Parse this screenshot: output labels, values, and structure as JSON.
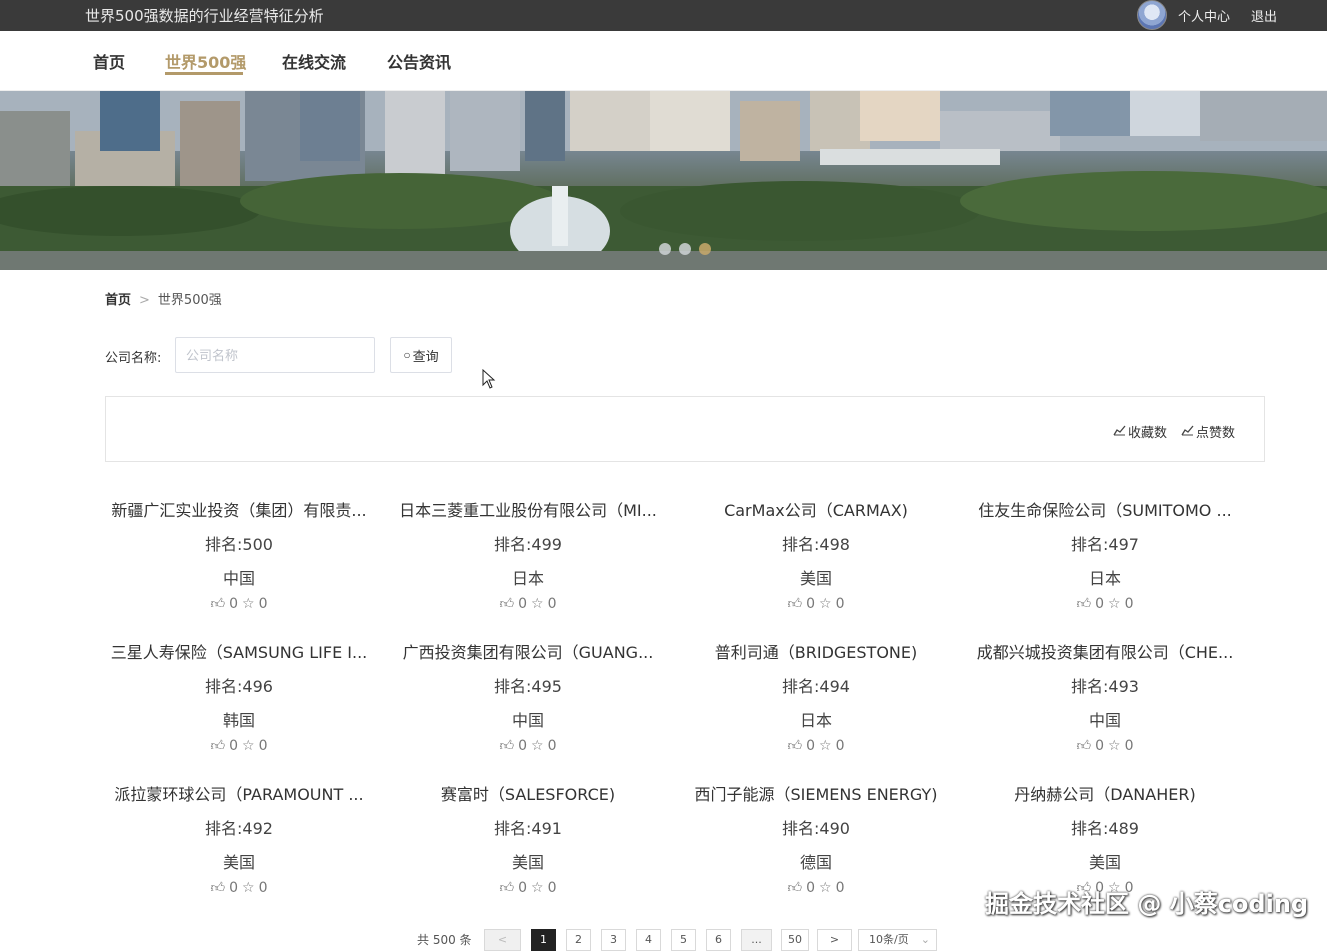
{
  "topbar": {
    "site_title": "世界500强数据的行业经营特征分析",
    "user_center": "个人中心",
    "logout": "退出"
  },
  "nav": {
    "items": [
      "首页",
      "世界500强",
      "在线交流",
      "公告资讯"
    ],
    "active_index": 1
  },
  "breadcrumb": {
    "home": "首页",
    "separator": ">",
    "current": "世界500强"
  },
  "search": {
    "label": "公司名称:",
    "placeholder": "公司名称",
    "button_label": "查询"
  },
  "sort": {
    "favorites": "收藏数",
    "likes": "点赞数"
  },
  "companies": [
    {
      "name": "新疆广汇实业投资（集团）有限责...",
      "rank": "排名:500",
      "country": "中国",
      "likes": "0",
      "favs": "0"
    },
    {
      "name": "日本三菱重工业股份有限公司（MI...",
      "rank": "排名:499",
      "country": "日本",
      "likes": "0",
      "favs": "0"
    },
    {
      "name": "CarMax公司（CARMAX)",
      "rank": "排名:498",
      "country": "美国",
      "likes": "0",
      "favs": "0"
    },
    {
      "name": "住友生命保险公司（SUMITOMO ...",
      "rank": "排名:497",
      "country": "日本",
      "likes": "0",
      "favs": "0"
    },
    {
      "name": "三星人寿保险（SAMSUNG LIFE I...",
      "rank": "排名:496",
      "country": "韩国",
      "likes": "0",
      "favs": "0"
    },
    {
      "name": "广西投资集团有限公司（GUANG...",
      "rank": "排名:495",
      "country": "中国",
      "likes": "0",
      "favs": "0"
    },
    {
      "name": "普利司通（BRIDGESTONE)",
      "rank": "排名:494",
      "country": "日本",
      "likes": "0",
      "favs": "0"
    },
    {
      "name": "成都兴城投资集团有限公司（CHE...",
      "rank": "排名:493",
      "country": "中国",
      "likes": "0",
      "favs": "0"
    },
    {
      "name": "派拉蒙环球公司（PARAMOUNT ...",
      "rank": "排名:492",
      "country": "美国",
      "likes": "0",
      "favs": "0"
    },
    {
      "name": "赛富时（SALESFORCE)",
      "rank": "排名:491",
      "country": "美国",
      "likes": "0",
      "favs": "0"
    },
    {
      "name": "西门子能源（SIEMENS ENERGY)",
      "rank": "排名:490",
      "country": "德国",
      "likes": "0",
      "favs": "0"
    },
    {
      "name": "丹纳赫公司（DANAHER)",
      "rank": "排名:489",
      "country": "美国",
      "likes": "0",
      "favs": "0"
    }
  ],
  "pagination": {
    "total": "共 500 条",
    "prev": "<",
    "pages": [
      "1",
      "2",
      "3",
      "4",
      "5",
      "6",
      "...",
      "50"
    ],
    "next": ">",
    "page_size": "10条/页",
    "current_page": "1"
  },
  "watermark": "掘金技术社区 @ 小蔡coding",
  "colors": {
    "topbar_bg": "#3a3a3a",
    "accent": "#b39a6a",
    "active_page_bg": "#222222"
  },
  "icons": {
    "search": "search-icon",
    "sort": "chart-icon",
    "like": "thumbs-up-icon",
    "favorite": "star-icon"
  }
}
